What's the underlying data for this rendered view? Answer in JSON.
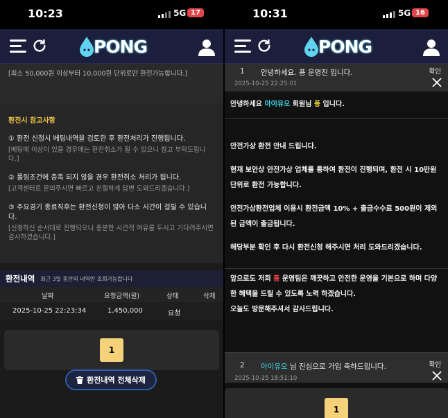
{
  "left": {
    "status": {
      "time": "10:23",
      "network": "5G",
      "battery": "17",
      "battery_color": "#e0454a"
    },
    "nav": {
      "logo_text": "PONG"
    },
    "notice": "[최소 50,000원 이상부터 10,000원 단위로만 환전가능합니다.]",
    "ref": {
      "title": "환전시 참고사항",
      "items": [
        {
          "main": "① 환전 신청시 베팅내역을 검토한 후 환전처리가 진행됩니다.",
          "sub": "[베팅에 이상이 있을 경우에는 환전취소가 될 수 있으니 참고 부탁드립니다.]"
        },
        {
          "main": "② 롤링조건에 충족 되지 않을 경우 환전취소 처리가 됩니다.",
          "sub": "[고객센터로 문의주시면 빠르고 친절하게 답변 도와드리겠습니다.]"
        },
        {
          "main": "③ 주요경기 종료직후는 환전신청이 많아 다소 시간이 걸릴 수 있습니다.",
          "sub": "[신청하신 순서대로 진행되오니 충분한 시간적 여유를 두시고 기다려주시면 감사하겠습니다.]"
        }
      ]
    },
    "history": {
      "title": "환전내역",
      "subtitle": "최근 3일 동안의 내역만 조회가능합니다",
      "columns": [
        "날짜",
        "요청금액(원)",
        "상태",
        "삭제"
      ],
      "rows": [
        {
          "date": "2025-10-25 22:23:34",
          "amount": "1,450,000",
          "status": "요청"
        }
      ]
    },
    "pager": {
      "page": "1"
    },
    "delete_all": "환전내역 전체삭제"
  },
  "right": {
    "status": {
      "time": "10:31",
      "network": "5G",
      "battery": "16",
      "battery_color": "#e0454a"
    },
    "nav": {
      "logo_text": "PONG"
    },
    "msg1": {
      "num": "1",
      "subject": "안녕하세요. 퐁 운영진 입니다.",
      "date": "2025-10-25 22:25:01",
      "confirm": "확인",
      "greet_a": "안녕하세요 ",
      "greet_user": "아이유오",
      "greet_b": " 회원님 ",
      "greet_brand": "퐁",
      "greet_c": " 입니다.",
      "p1": "안전가상 환전 안내 드립니다.",
      "p2": "현재 보안상 안전가상 업체를 통하여 환전이 진행되며, 환전 시 10만원 단위로 환전 가능합니다.",
      "p3": "안전가상환전업체 이용시 환전금액 10% + 출금수수료 500원이 제외된 금액이 출금됩니다.",
      "p4": "해당부분 확인 후 다시 환전신청 해주시면 처리 도와드리겠습니다.",
      "p5a": "앞으로도 저희 ",
      "p5brand": "퐁",
      "p5b": " 운영팀은 깨끗하고 안전한 운영을 기본으로 하며 다양한 혜택을 드릴 수 있도록 노력 하겠습니다.",
      "p6": "오늘도 방문해주셔서 감사드립니다."
    },
    "msg2": {
      "num": "2",
      "user": "아이유오",
      "subject_rest": " 님 진심으로 가입 축하드립니다.",
      "date": "2025-10-25 18:51:10",
      "confirm": "확인"
    },
    "pager": {
      "page": "1"
    }
  }
}
